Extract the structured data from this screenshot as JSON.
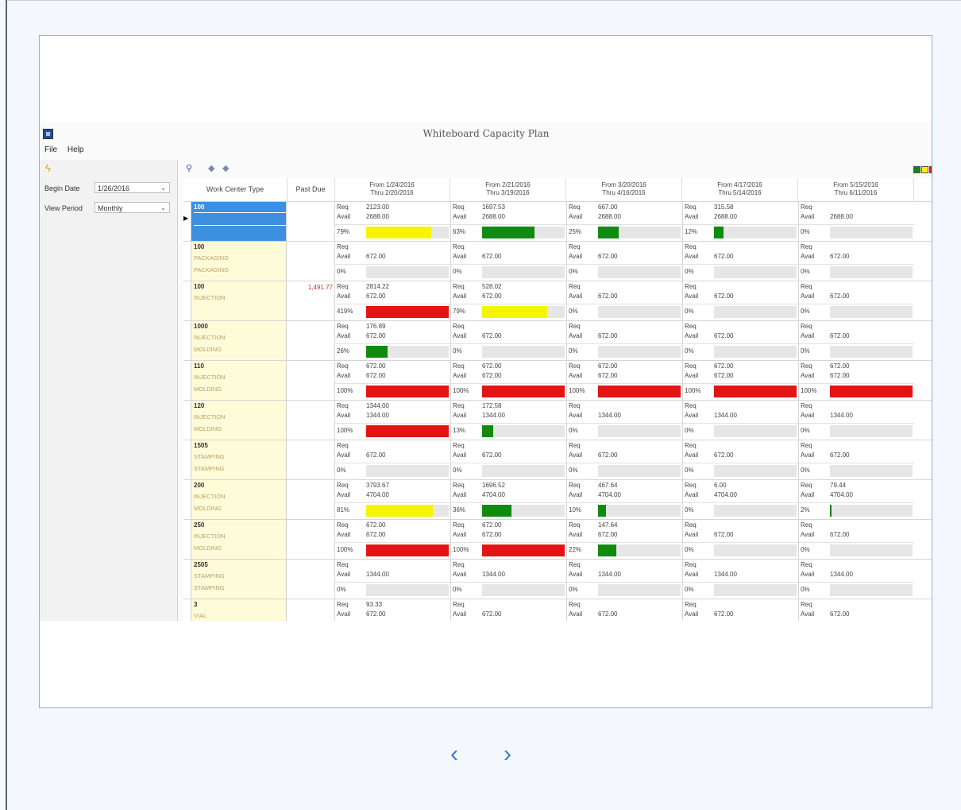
{
  "window": {
    "title": "Whiteboard Capacity Plan"
  },
  "menu": [
    "File",
    "Help"
  ],
  "left_panel": {
    "begin_date_label": "Begin Date",
    "begin_date_value": "1/26/2016",
    "view_period_label": "View Period",
    "view_period_value": "Monthly"
  },
  "legend_colors": [
    "#118a11",
    "#f5f500",
    "#e31414"
  ],
  "columns": {
    "work_center": "Work Center Type",
    "past_due": "Past Due",
    "periods": [
      {
        "from": "From 1/24/2016",
        "thru": "Thru 2/20/2016"
      },
      {
        "from": "From 2/21/2016",
        "thru": "Thru 3/19/2016"
      },
      {
        "from": "From 3/20/2016",
        "thru": "Thru 4/16/2016"
      },
      {
        "from": "From 4/17/2016",
        "thru": "Thru 5/14/2016"
      },
      {
        "from": "From 5/15/2016",
        "thru": "Thru 6/11/2016"
      }
    ]
  },
  "labels": {
    "req": "Req",
    "avail": "Avail"
  },
  "rows": [
    {
      "code": "100",
      "l2": "",
      "l3": "",
      "selected": true,
      "past_due": "",
      "cells": [
        {
          "req": "2123.00",
          "avail": "2688.00",
          "pct": "79%",
          "fill": 0.79,
          "color": "yellow"
        },
        {
          "req": "1697.53",
          "avail": "2688.00",
          "pct": "63%",
          "fill": 0.63,
          "color": "green"
        },
        {
          "req": "667.00",
          "avail": "2688.00",
          "pct": "25%",
          "fill": 0.25,
          "color": "green"
        },
        {
          "req": "315.58",
          "avail": "2688.00",
          "pct": "12%",
          "fill": 0.12,
          "color": "green"
        },
        {
          "req": "",
          "avail": "2688.00",
          "pct": "0%",
          "fill": 0,
          "color": "green"
        }
      ]
    },
    {
      "code": "100",
      "l2": "PACKAGING",
      "l3": "PACKAGING",
      "past_due": "",
      "cells": [
        {
          "req": "",
          "avail": "672.00",
          "pct": "0%",
          "fill": 0,
          "color": "green"
        },
        {
          "req": "",
          "avail": "672.00",
          "pct": "0%",
          "fill": 0,
          "color": "green"
        },
        {
          "req": "",
          "avail": "672.00",
          "pct": "0%",
          "fill": 0,
          "color": "green"
        },
        {
          "req": "",
          "avail": "672.00",
          "pct": "0%",
          "fill": 0,
          "color": "green"
        },
        {
          "req": "",
          "avail": "672.00",
          "pct": "0%",
          "fill": 0,
          "color": "green"
        }
      ]
    },
    {
      "code": "100",
      "l2": "INJECTION",
      "l3": "",
      "past_due": "1,491.77",
      "cells": [
        {
          "req": "2814.22",
          "avail": "672.00",
          "pct": "419%",
          "fill": 1,
          "color": "red"
        },
        {
          "req": "528.02",
          "avail": "672.00",
          "pct": "79%",
          "fill": 0.79,
          "color": "yellow"
        },
        {
          "req": "",
          "avail": "672.00",
          "pct": "0%",
          "fill": 0,
          "color": "green"
        },
        {
          "req": "",
          "avail": "672.00",
          "pct": "0%",
          "fill": 0,
          "color": "green"
        },
        {
          "req": "",
          "avail": "672.00",
          "pct": "0%",
          "fill": 0,
          "color": "green"
        }
      ]
    },
    {
      "code": "1000",
      "l2": "INJECTION",
      "l3": "MOLDING",
      "past_due": "",
      "cells": [
        {
          "req": "176.89",
          "avail": "672.00",
          "pct": "26%",
          "fill": 0.26,
          "color": "green"
        },
        {
          "req": "",
          "avail": "672.00",
          "pct": "0%",
          "fill": 0,
          "color": "green"
        },
        {
          "req": "",
          "avail": "672.00",
          "pct": "0%",
          "fill": 0,
          "color": "green"
        },
        {
          "req": "",
          "avail": "672.00",
          "pct": "0%",
          "fill": 0,
          "color": "green"
        },
        {
          "req": "",
          "avail": "672.00",
          "pct": "0%",
          "fill": 0,
          "color": "green"
        }
      ]
    },
    {
      "code": "110",
      "l2": "INJECTION",
      "l3": "MOLDING",
      "past_due": "",
      "cells": [
        {
          "req": "672.00",
          "avail": "672.00",
          "pct": "100%",
          "fill": 1,
          "color": "red"
        },
        {
          "req": "672.00",
          "avail": "672.00",
          "pct": "100%",
          "fill": 1,
          "color": "red"
        },
        {
          "req": "672.00",
          "avail": "672.00",
          "pct": "100%",
          "fill": 1,
          "color": "red"
        },
        {
          "req": "672.00",
          "avail": "672.00",
          "pct": "100%",
          "fill": 1,
          "color": "red"
        },
        {
          "req": "672.00",
          "avail": "672.00",
          "pct": "100%",
          "fill": 1,
          "color": "red"
        }
      ]
    },
    {
      "code": "120",
      "l2": "INJECTION",
      "l3": "MOLDING",
      "past_due": "",
      "cells": [
        {
          "req": "1344.00",
          "avail": "1344.00",
          "pct": "100%",
          "fill": 1,
          "color": "red"
        },
        {
          "req": "172.58",
          "avail": "1344.00",
          "pct": "13%",
          "fill": 0.13,
          "color": "green"
        },
        {
          "req": "",
          "avail": "1344.00",
          "pct": "0%",
          "fill": 0,
          "color": "green"
        },
        {
          "req": "",
          "avail": "1344.00",
          "pct": "0%",
          "fill": 0,
          "color": "green"
        },
        {
          "req": "",
          "avail": "1344.00",
          "pct": "0%",
          "fill": 0,
          "color": "green"
        }
      ]
    },
    {
      "code": "1505",
      "l2": "STAMPING",
      "l3": "STAMPING",
      "past_due": "",
      "cells": [
        {
          "req": "",
          "avail": "672.00",
          "pct": "0%",
          "fill": 0,
          "color": "green"
        },
        {
          "req": "",
          "avail": "672.00",
          "pct": "0%",
          "fill": 0,
          "color": "green"
        },
        {
          "req": "",
          "avail": "672.00",
          "pct": "0%",
          "fill": 0,
          "color": "green"
        },
        {
          "req": "",
          "avail": "672.00",
          "pct": "0%",
          "fill": 0,
          "color": "green"
        },
        {
          "req": "",
          "avail": "672.00",
          "pct": "0%",
          "fill": 0,
          "color": "green"
        }
      ]
    },
    {
      "code": "200",
      "l2": "INJECTION",
      "l3": "MOLDING",
      "past_due": "",
      "cells": [
        {
          "req": "3793.67",
          "avail": "4704.00",
          "pct": "81%",
          "fill": 0.81,
          "color": "yellow"
        },
        {
          "req": "1696.52",
          "avail": "4704.00",
          "pct": "36%",
          "fill": 0.36,
          "color": "green"
        },
        {
          "req": "467.64",
          "avail": "4704.00",
          "pct": "10%",
          "fill": 0.1,
          "color": "green"
        },
        {
          "req": "6.00",
          "avail": "4704.00",
          "pct": "0%",
          "fill": 0,
          "color": "green"
        },
        {
          "req": "79.44",
          "avail": "4704.00",
          "pct": "2%",
          "fill": 0.02,
          "color": "green"
        }
      ]
    },
    {
      "code": "250",
      "l2": "INJECTION",
      "l3": "MOLDING",
      "past_due": "",
      "cells": [
        {
          "req": "672.00",
          "avail": "672.00",
          "pct": "100%",
          "fill": 1,
          "color": "red"
        },
        {
          "req": "672.00",
          "avail": "672.00",
          "pct": "100%",
          "fill": 1,
          "color": "red"
        },
        {
          "req": "147.64",
          "avail": "672.00",
          "pct": "22%",
          "fill": 0.22,
          "color": "green"
        },
        {
          "req": "",
          "avail": "672.00",
          "pct": "0%",
          "fill": 0,
          "color": "green"
        },
        {
          "req": "",
          "avail": "672.00",
          "pct": "0%",
          "fill": 0,
          "color": "green"
        }
      ]
    },
    {
      "code": "2505",
      "l2": "STAMPING",
      "l3": "STAMPING",
      "past_due": "",
      "cells": [
        {
          "req": "",
          "avail": "1344.00",
          "pct": "0%",
          "fill": 0,
          "color": "green"
        },
        {
          "req": "",
          "avail": "1344.00",
          "pct": "0%",
          "fill": 0,
          "color": "green"
        },
        {
          "req": "",
          "avail": "1344.00",
          "pct": "0%",
          "fill": 0,
          "color": "green"
        },
        {
          "req": "",
          "avail": "1344.00",
          "pct": "0%",
          "fill": 0,
          "color": "green"
        },
        {
          "req": "",
          "avail": "1344.00",
          "pct": "0%",
          "fill": 0,
          "color": "green"
        }
      ]
    },
    {
      "code": "3",
      "l2": "VIAL",
      "l3": "",
      "past_due": "",
      "cells": [
        {
          "req": "93.33",
          "avail": "672.00",
          "pct": "",
          "fill": 0.14,
          "color": "green"
        },
        {
          "req": "",
          "avail": "672.00",
          "pct": "",
          "fill": 0,
          "color": "green"
        },
        {
          "req": "",
          "avail": "672.00",
          "pct": "",
          "fill": 0,
          "color": "green"
        },
        {
          "req": "",
          "avail": "672.00",
          "pct": "",
          "fill": 0,
          "color": "green"
        },
        {
          "req": "",
          "avail": "672.00",
          "pct": "",
          "fill": 0,
          "color": "green"
        }
      ]
    }
  ],
  "bar_colors": {
    "green": "#118a11",
    "yellow": "#f5f500",
    "red": "#e31414"
  },
  "nav": {
    "prev_icon": "chevron-left-icon",
    "next_icon": "chevron-right-icon",
    "prev": "‹",
    "next": "›"
  }
}
